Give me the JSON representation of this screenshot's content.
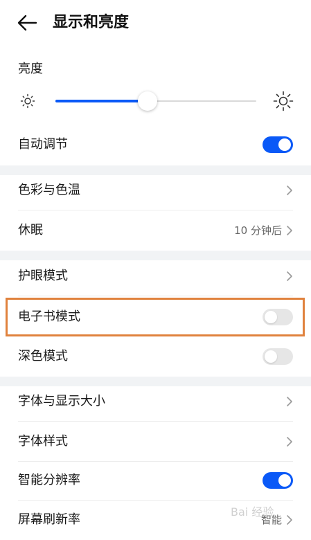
{
  "header": {
    "title": "显示和亮度"
  },
  "brightness": {
    "label": "亮度",
    "level_fraction": 0.46
  },
  "rows": [
    {
      "id": "auto",
      "label": "自动调节",
      "toggle": true
    },
    {
      "id": "color",
      "label": "色彩与色温"
    },
    {
      "id": "sleep",
      "label": "休眠",
      "value": "10 分钟后"
    },
    {
      "id": "eyecare",
      "label": "护眼模式"
    },
    {
      "id": "ebook",
      "label": "电子书模式",
      "toggle": false
    },
    {
      "id": "dark",
      "label": "深色模式",
      "toggle": false
    },
    {
      "id": "fontsize",
      "label": "字体与显示大小"
    },
    {
      "id": "fontstyle",
      "label": "字体样式"
    },
    {
      "id": "resolution",
      "label": "智能分辨率",
      "toggle": true
    },
    {
      "id": "refresh",
      "label": "屏幕刷新率",
      "value": "智能"
    }
  ],
  "watermark": {
    "text": "Bai 经验"
  },
  "colors": {
    "accent": "#0a59f7",
    "highlight": "#e0823d",
    "toggle_off": "#e6e6e6"
  }
}
